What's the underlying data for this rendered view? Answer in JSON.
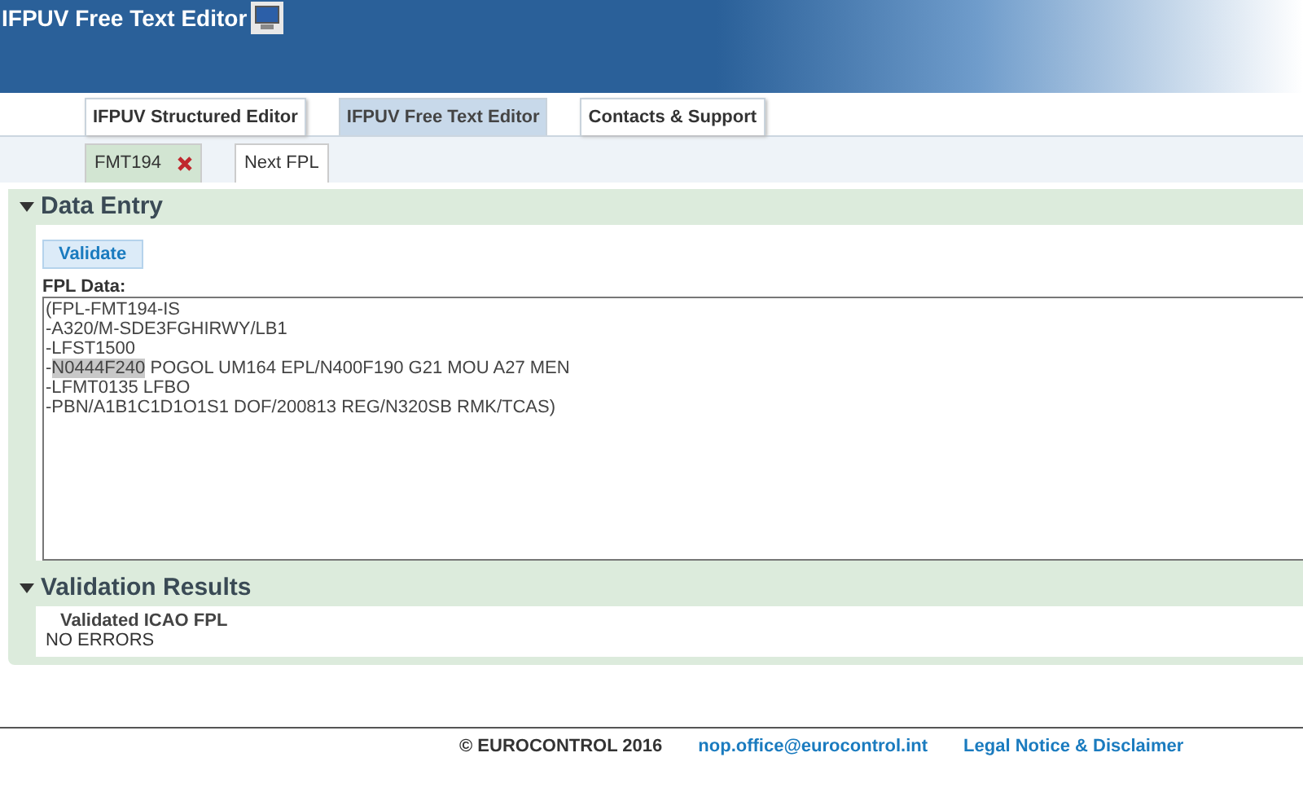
{
  "header": {
    "title": "IFPUV Free Text Editor"
  },
  "nav_tabs": [
    {
      "label": "IFPUV Structured Editor",
      "selected": false
    },
    {
      "label": "IFPUV Free Text Editor",
      "selected": true
    },
    {
      "label": "Contacts & Support",
      "selected": false
    }
  ],
  "doc_tabs": [
    {
      "label": "FMT194",
      "selected": true,
      "closable": true
    },
    {
      "label": "Next FPL",
      "selected": false,
      "closable": false
    }
  ],
  "data_entry": {
    "title": "Data Entry",
    "expanded": true,
    "validate_button": "Validate",
    "field_label": "FPL Data:",
    "lines": [
      [
        {
          "text": "(FPL-FMT194-IS",
          "selected": false
        }
      ],
      [
        {
          "text": "-A320/M-SDE3FGHIRWY/LB1",
          "selected": false
        }
      ],
      [
        {
          "text": "-LFST1500",
          "selected": false
        }
      ],
      [
        {
          "text": "-",
          "selected": false
        },
        {
          "text": "N0444F240",
          "selected": true
        },
        {
          "text": " POGOL UM164 EPL/N400F190 G21 MOU A27 MEN",
          "selected": false
        }
      ],
      [
        {
          "text": "-LFMT0135 LFBO",
          "selected": false
        }
      ],
      [
        {
          "text": "-PBN/A1B1C1D1O1S1 DOF/200813 REG/N320SB RMK/TCAS)",
          "selected": false
        }
      ]
    ]
  },
  "validation_results": {
    "title": "Validation Results",
    "expanded": true,
    "heading": "Validated ICAO FPL",
    "result": "NO ERRORS"
  },
  "footer": {
    "copyright": "© EUROCONTROL 2016",
    "email": "nop.office@eurocontrol.int",
    "legal_link": "Legal Notice & Disclaimer"
  }
}
